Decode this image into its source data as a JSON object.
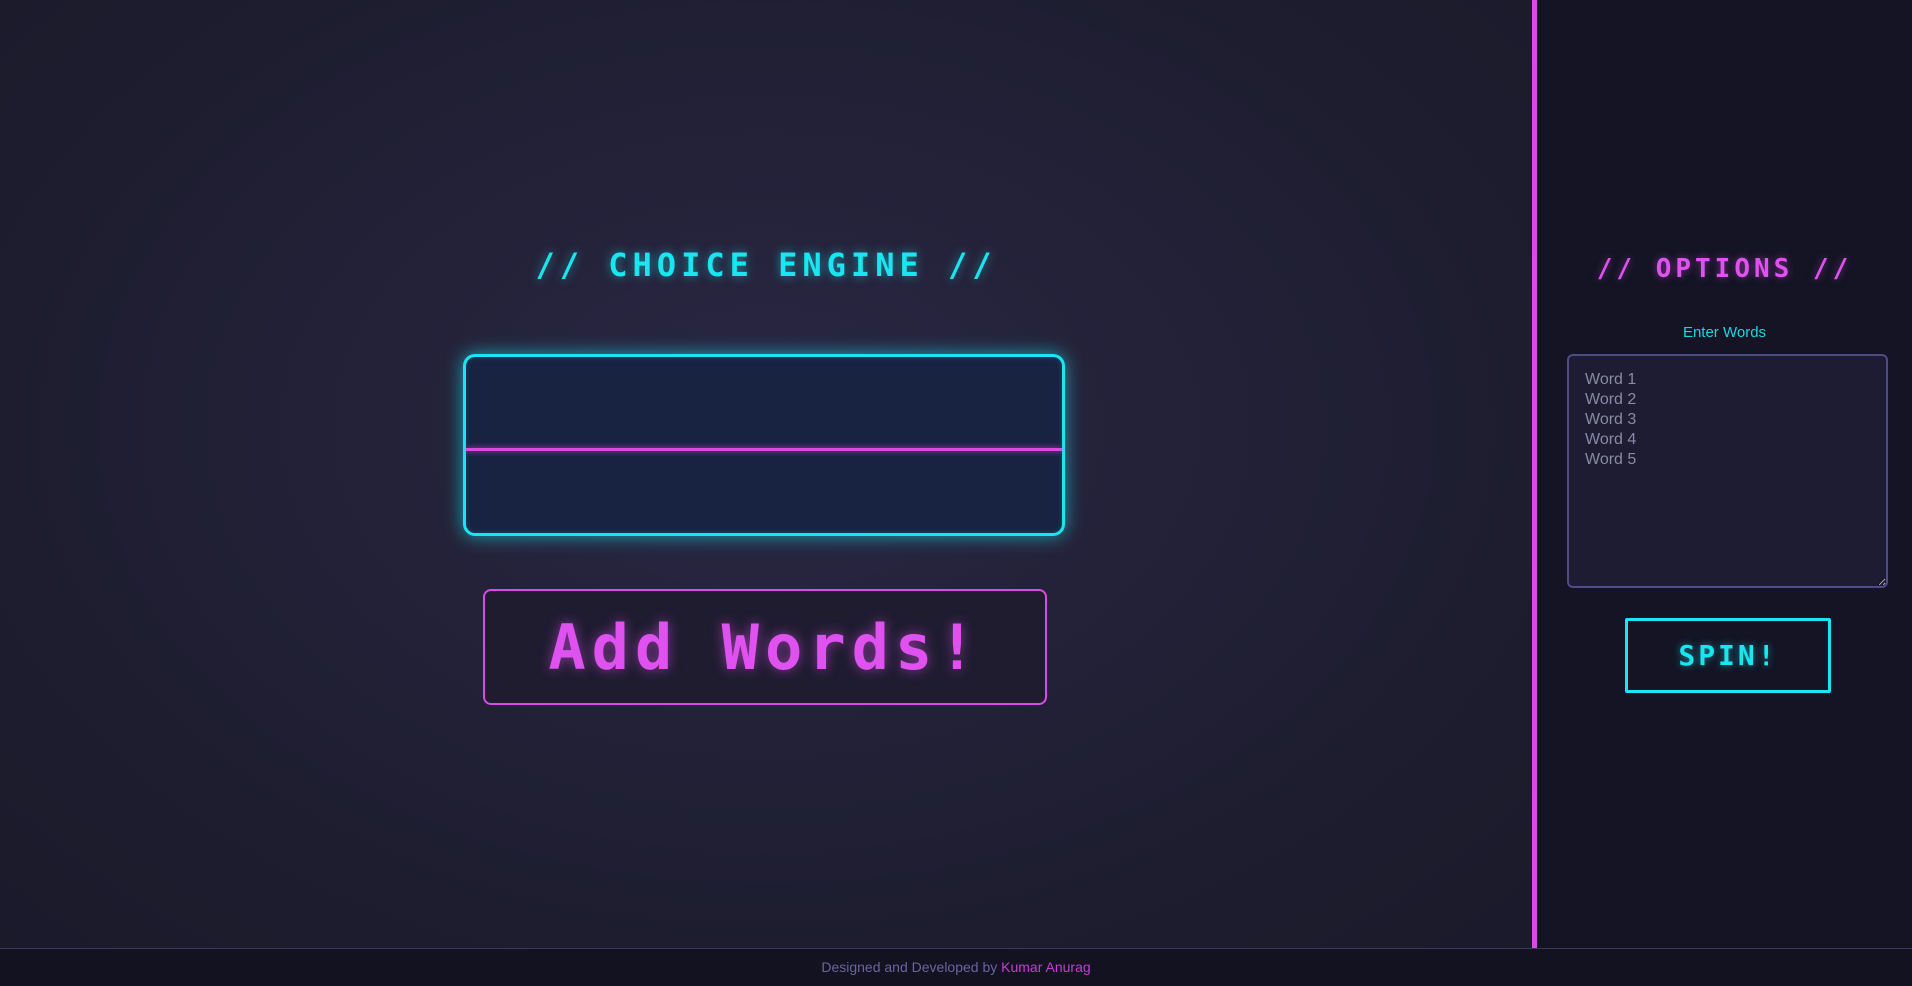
{
  "main": {
    "title": "// CHOICE ENGINE //",
    "result_text": "",
    "add_words_label": "Add Words!"
  },
  "sidebar": {
    "title": "// OPTIONS //",
    "enter_label": "Enter Words",
    "words_placeholder": "Word 1\nWord 2\nWord 3\nWord 4\nWord 5",
    "words_value": "",
    "spin_label": "SPIN!"
  },
  "footer": {
    "prefix": "Designed and Developed by",
    "author": "Kumar Anurag"
  },
  "colors": {
    "cyan_accent": "#19e6f0",
    "magenta_accent": "#d84be6",
    "background": "#1c1c2e",
    "sidebar_background": "#141424"
  }
}
